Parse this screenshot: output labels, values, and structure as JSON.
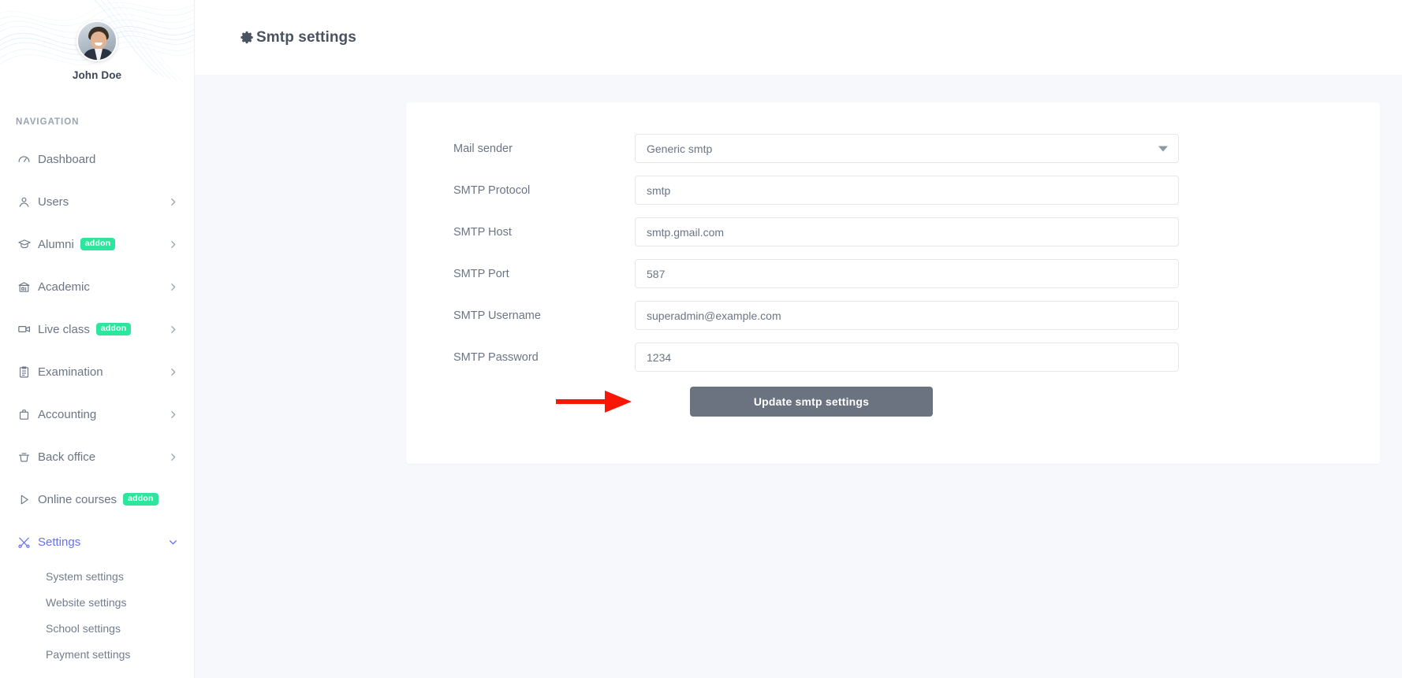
{
  "sidebar": {
    "profile": {
      "name": "John Doe",
      "avatar_alt": "user-avatar"
    },
    "nav_title": "NAVIGATION",
    "items": [
      {
        "label": "Dashboard",
        "icon": "gauge-icon",
        "badge": null,
        "has_chevron": false,
        "active": false
      },
      {
        "label": "Users",
        "icon": "person-icon",
        "badge": null,
        "has_chevron": true,
        "active": false
      },
      {
        "label": "Alumni",
        "icon": "graduation-cap-icon",
        "badge": "addon",
        "has_chevron": true,
        "active": false
      },
      {
        "label": "Academic",
        "icon": "bank-icon",
        "badge": null,
        "has_chevron": true,
        "active": false
      },
      {
        "label": "Live class",
        "icon": "video-camera-icon",
        "badge": "addon",
        "has_chevron": true,
        "active": false
      },
      {
        "label": "Examination",
        "icon": "clipboard-icon",
        "badge": null,
        "has_chevron": true,
        "active": false
      },
      {
        "label": "Accounting",
        "icon": "briefcase-icon",
        "badge": null,
        "has_chevron": true,
        "active": false
      },
      {
        "label": "Back office",
        "icon": "basket-icon",
        "badge": null,
        "has_chevron": true,
        "active": false
      },
      {
        "label": "Online courses",
        "icon": "play-triangle-icon",
        "badge": "addon",
        "has_chevron": false,
        "active": false
      },
      {
        "label": "Settings",
        "icon": "tools-icon",
        "badge": null,
        "has_chevron": true,
        "active": true
      }
    ],
    "settings_submenu": [
      {
        "label": "System settings"
      },
      {
        "label": "Website settings"
      },
      {
        "label": "School settings"
      },
      {
        "label": "Payment settings"
      }
    ]
  },
  "header": {
    "title": "Smtp settings",
    "icon": "gear-icon"
  },
  "form": {
    "fields": [
      {
        "label": "Mail sender",
        "value": "Generic smtp",
        "type": "select"
      },
      {
        "label": "SMTP Protocol",
        "value": "smtp",
        "type": "text"
      },
      {
        "label": "SMTP Host",
        "value": "smtp.gmail.com",
        "type": "text"
      },
      {
        "label": "SMTP Port",
        "value": "587",
        "type": "text"
      },
      {
        "label": "SMTP Username",
        "value": "superadmin@example.com",
        "type": "text"
      },
      {
        "label": "SMTP Password",
        "value": "1234",
        "type": "text"
      }
    ],
    "submit_label": "Update smtp settings"
  },
  "annotation": {
    "arrow": "red-arrow-pointing-right",
    "color": "#fa1605"
  },
  "colors": {
    "accent": "#6474ec",
    "badge_green": "#2ee59d",
    "button_gray": "#6b7280",
    "page_bg": "#f7f8fb",
    "text_muted": "#6b7585"
  }
}
